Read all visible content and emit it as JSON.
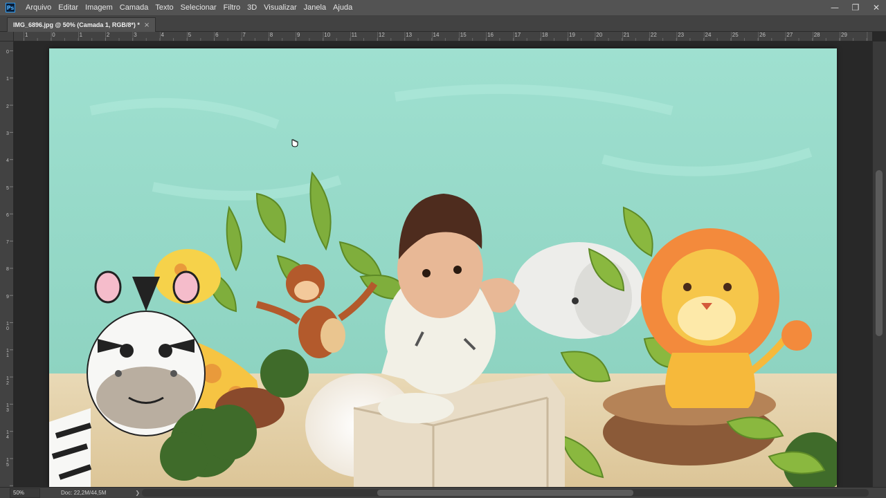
{
  "app": {
    "logo": "Ps"
  },
  "menu": [
    "Arquivo",
    "Editar",
    "Imagem",
    "Camada",
    "Texto",
    "Selecionar",
    "Filtro",
    "3D",
    "Visualizar",
    "Janela",
    "Ajuda"
  ],
  "window_controls": {
    "minimize": "—",
    "restore": "❐",
    "close": "✕"
  },
  "document_tab": {
    "title": "IMG_6896.jpg @ 50% (Camada 1, RGB/8*) *",
    "close": "×"
  },
  "ruler_h_labels": [
    "1",
    "0",
    "1",
    "2",
    "3",
    "4",
    "5",
    "6",
    "7",
    "8",
    "9",
    "10",
    "11",
    "12",
    "13",
    "14",
    "15",
    "16",
    "17",
    "18",
    "19",
    "20",
    "21",
    "22",
    "23",
    "24",
    "25",
    "26",
    "27",
    "28",
    "29"
  ],
  "ruler_v_labels": [
    "0",
    "1",
    "2",
    "3",
    "4",
    "5",
    "6",
    "7",
    "8",
    "9",
    "1 0",
    "1 1",
    "1 2",
    "1 3",
    "1 4",
    "1 5"
  ],
  "status": {
    "zoom": "50%",
    "doc_info": "Doc: 22,2M/44,5M",
    "arrow": "❯"
  },
  "colors": {
    "workspace": "#282828",
    "panel": "#424242",
    "menubar": "#535353",
    "backdrop": "#9edfcf"
  }
}
